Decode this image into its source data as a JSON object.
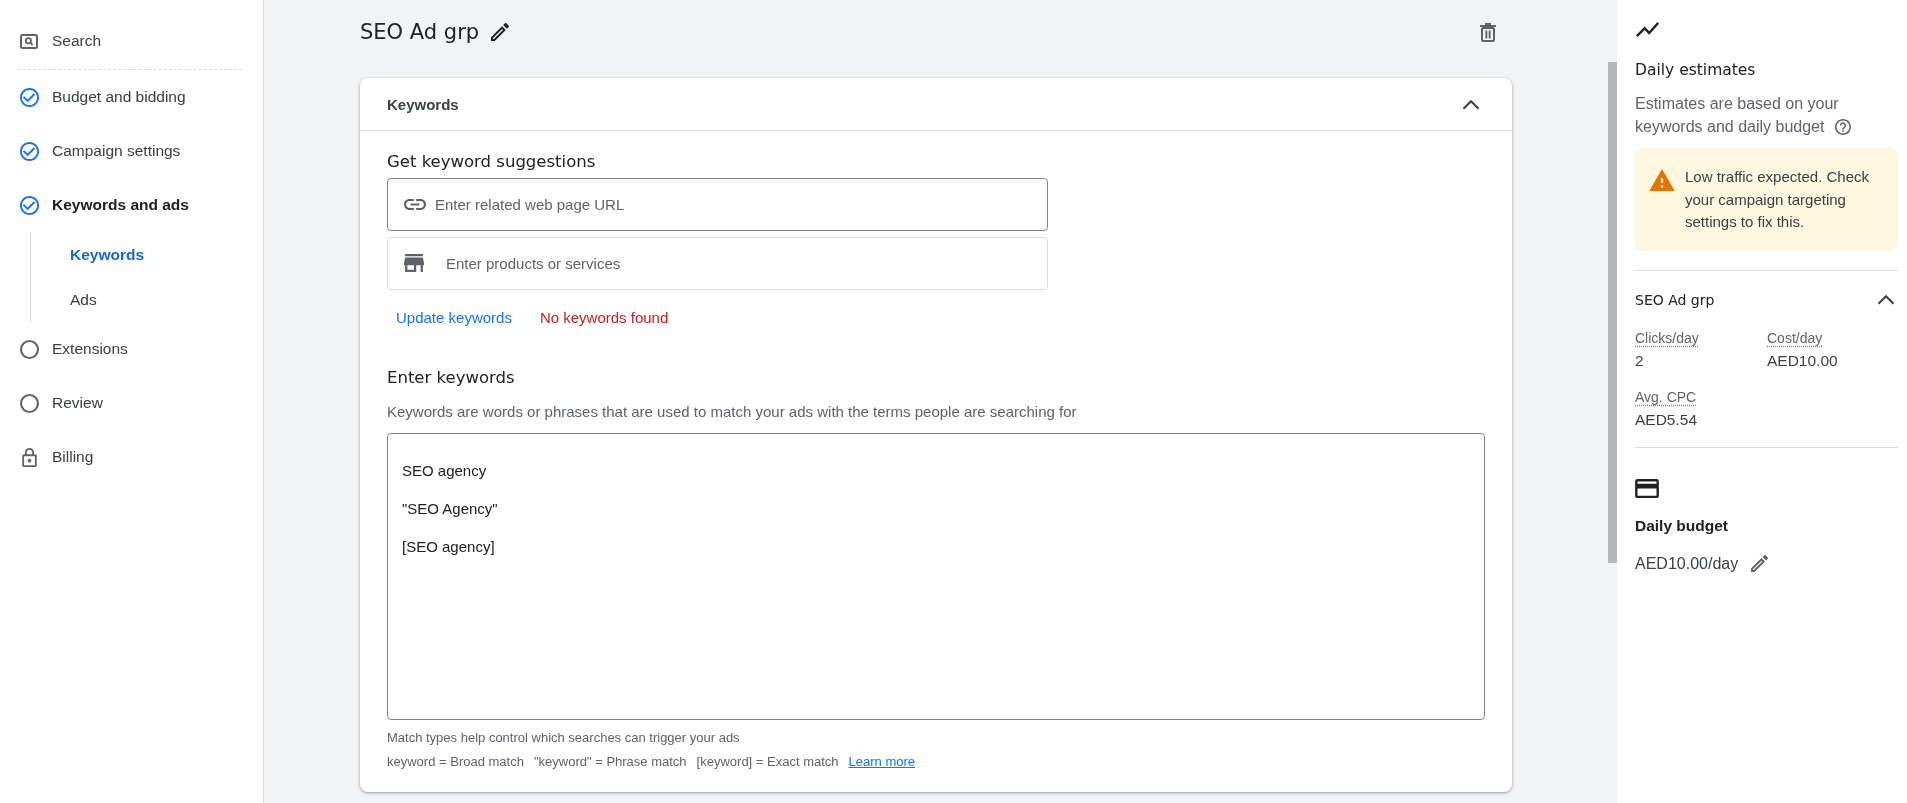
{
  "sidebar": {
    "campaign_type": {
      "label": "Search"
    },
    "steps": [
      {
        "label": "Budget and bidding",
        "kind": "step",
        "completed": true,
        "selected": false
      },
      {
        "label": "Campaign settings",
        "kind": "step",
        "completed": true,
        "selected": false
      },
      {
        "label": "Keywords and ads",
        "kind": "step",
        "completed": true,
        "selected": true,
        "children": [
          {
            "label": "Keywords",
            "selected": true
          },
          {
            "label": "Ads",
            "selected": false
          }
        ]
      },
      {
        "label": "Extensions",
        "kind": "step",
        "completed": false,
        "selected": false
      },
      {
        "label": "Review",
        "kind": "step",
        "completed": false,
        "selected": false
      },
      {
        "label": "Billing",
        "kind": "locked",
        "completed": false,
        "selected": false
      }
    ]
  },
  "ad_group": {
    "title": "SEO Ad grp"
  },
  "keywords_card": {
    "title": "Keywords",
    "expanded": true,
    "suggestions": {
      "heading": "Get keyword suggestions",
      "fields": [
        {
          "kind": "url",
          "placeholder": "Enter related web page URL",
          "hovered": true
        },
        {
          "kind": "products",
          "placeholder": "Enter products or services",
          "hovered": false
        }
      ],
      "update_link": "Update keywords",
      "status": "No keywords found"
    },
    "entry": {
      "heading": "Enter keywords",
      "description": "Keywords are words or phrases that are used to match your ads with the terms people are searching for",
      "keywords": [
        "SEO agency",
        "\"SEO Agency\"",
        "[SEO agency]"
      ],
      "help": "Match types help control which searches can trigger your ads",
      "match_types": [
        "keyword = Broad match",
        "\"keyword\" = Phrase match",
        "[keyword] = Exact match"
      ],
      "learn_more": "Learn more"
    }
  },
  "estimates": {
    "title": "Daily estimates",
    "description": "Estimates are based on your keywords and daily budget",
    "warning": "Low traffic expected. Check your campaign targeting settings to fix this.",
    "ad_group": {
      "name": "SEO Ad grp",
      "expanded": true,
      "metrics": [
        {
          "label": "Clicks/day",
          "value": "2"
        },
        {
          "label": "Cost/day",
          "value": "AED10.00"
        },
        {
          "label": "Avg. CPC",
          "value": "AED5.54"
        }
      ]
    }
  },
  "budget": {
    "title": "Daily budget",
    "value": "AED10.00/day"
  }
}
